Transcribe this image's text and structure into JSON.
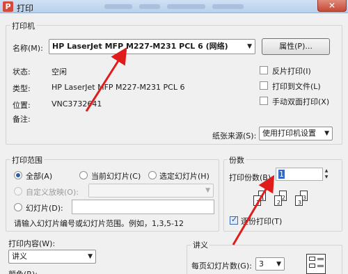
{
  "window": {
    "title": "打印",
    "logo_glyph": "P",
    "close_glyph": "✕"
  },
  "printer": {
    "group_title": "打印机",
    "name_label": "名称(M):",
    "name_value": "HP LaserJet MFP M227-M231 PCL 6 (网络)",
    "properties_button": "属性(P)...",
    "status_label": "状态:",
    "status_value": "空闲",
    "type_label": "类型:",
    "type_value": "HP LaserJet MFP M227-M231 PCL 6",
    "location_label": "位置:",
    "location_value": "VNC3732641",
    "comment_label": "备注:",
    "reverse_print": "反片打印(I)",
    "print_to_file": "打印到文件(L)",
    "manual_duplex": "手动双面打印(X)",
    "paper_source_label": "纸张来源(S):",
    "paper_source_value": "使用打印机设置"
  },
  "range": {
    "group_title": "打印范围",
    "all": "全部(A)",
    "current_slide": "当前幻灯片(C)",
    "selected_slides": "选定幻灯片(H)",
    "custom_show": "自定义放映(O):",
    "slides": "幻灯片(D):",
    "hint": "请输入幻灯片编号或幻灯片范围。例如，1,3,5-12"
  },
  "copies": {
    "group_title": "份数",
    "count_label": "打印份数(B):",
    "count_value": "1",
    "collate": "逐份打印(T)",
    "page_numbers": [
      "1",
      "2",
      "3",
      "1",
      "2",
      "3"
    ]
  },
  "content": {
    "label": "打印内容(W):",
    "value": "讲义",
    "color_label": "颜色(R):"
  },
  "handout": {
    "group_title": "讲义",
    "per_page_label": "每页幻灯片数(G):",
    "per_page_value": "3"
  },
  "colors": {
    "annotation_arrow": "#e01b1b",
    "accent": "#2b5fa7"
  }
}
